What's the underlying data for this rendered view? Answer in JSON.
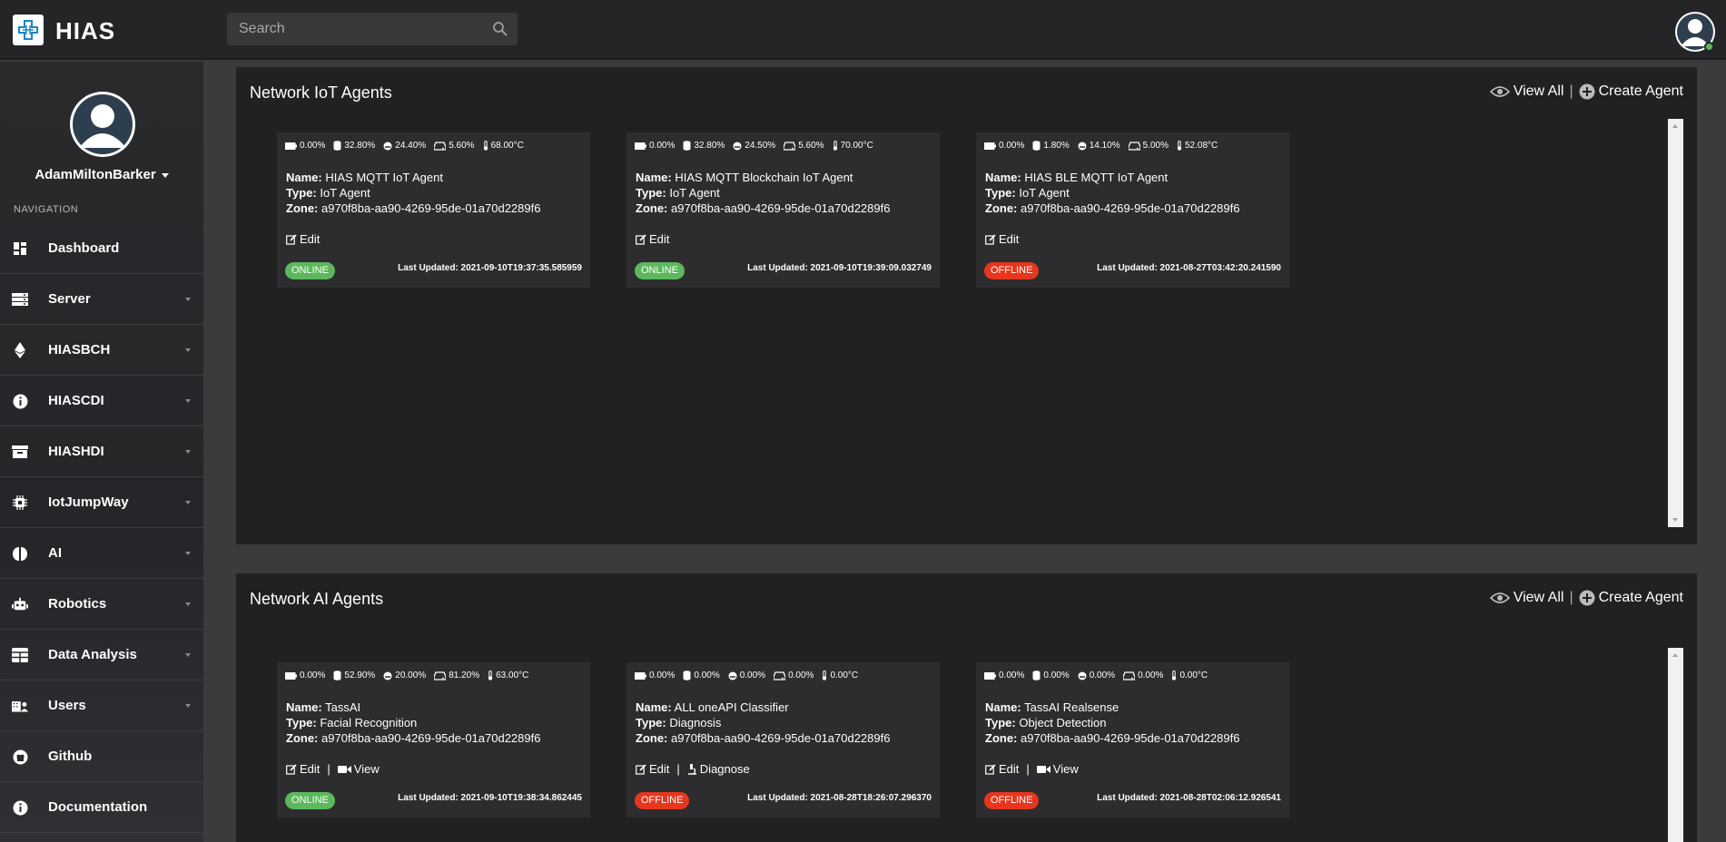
{
  "app": {
    "brand": "HIAS"
  },
  "search": {
    "placeholder": "Search"
  },
  "user": {
    "name": "AdamMiltonBarker"
  },
  "nav": {
    "section_label": "NAVIGATION",
    "items": [
      {
        "label": "Dashboard",
        "icon": "dashboard-icon",
        "has_caret": false
      },
      {
        "label": "Server",
        "icon": "server-icon",
        "has_caret": true
      },
      {
        "label": "HIASBCH",
        "icon": "ethereum-icon",
        "has_caret": true
      },
      {
        "label": "HIASCDI",
        "icon": "info-icon",
        "has_caret": true
      },
      {
        "label": "HIASHDI",
        "icon": "archive-icon",
        "has_caret": true
      },
      {
        "label": "IotJumpWay",
        "icon": "chip-icon",
        "has_caret": true
      },
      {
        "label": "AI",
        "icon": "brain-icon",
        "has_caret": true
      },
      {
        "label": "Robotics",
        "icon": "robot-icon",
        "has_caret": true
      },
      {
        "label": "Data Analysis",
        "icon": "table-icon",
        "has_caret": true
      },
      {
        "label": "Users",
        "icon": "users-icon",
        "has_caret": true
      },
      {
        "label": "Github",
        "icon": "github-icon",
        "has_caret": false
      },
      {
        "label": "Documentation",
        "icon": "info-icon",
        "has_caret": false
      }
    ]
  },
  "panels": {
    "iot": {
      "title": "Network IoT Agents",
      "view_all": "View All",
      "separator": "|",
      "create": "Create Agent",
      "agents": [
        {
          "battery": "0.00%",
          "cpu": "32.80%",
          "memory": "24.40%",
          "hdd": "5.60%",
          "temp": "68.00°C",
          "name_label": "Name:",
          "name": "HIAS MQTT IoT Agent",
          "type_label": "Type:",
          "type": "IoT Agent",
          "zone_label": "Zone:",
          "zone": "a970f8ba-aa90-4269-95de-01a70d2289f6",
          "edit": "Edit",
          "status": "ONLINE",
          "updated": "Last Updated: 2021-09-10T19:37:35.585959"
        },
        {
          "battery": "0.00%",
          "cpu": "32.80%",
          "memory": "24.50%",
          "hdd": "5.60%",
          "temp": "70.00°C",
          "name_label": "Name:",
          "name": "HIAS MQTT Blockchain IoT Agent",
          "type_label": "Type:",
          "type": "IoT Agent",
          "zone_label": "Zone:",
          "zone": "a970f8ba-aa90-4269-95de-01a70d2289f6",
          "edit": "Edit",
          "status": "ONLINE",
          "updated": "Last Updated: 2021-09-10T19:39:09.032749"
        },
        {
          "battery": "0.00%",
          "cpu": "1.80%",
          "memory": "14.10%",
          "hdd": "5.00%",
          "temp": "52.08°C",
          "name_label": "Name:",
          "name": "HIAS BLE MQTT IoT Agent",
          "type_label": "Type:",
          "type": "IoT Agent",
          "zone_label": "Zone:",
          "zone": "a970f8ba-aa90-4269-95de-01a70d2289f6",
          "edit": "Edit",
          "status": "OFFLINE",
          "updated": "Last Updated: 2021-08-27T03:42:20.241590"
        }
      ]
    },
    "ai": {
      "title": "Network AI Agents",
      "view_all": "View All",
      "separator": "|",
      "create": "Create Agent",
      "agents": [
        {
          "battery": "0.00%",
          "cpu": "52.90%",
          "memory": "20.00%",
          "hdd": "81.20%",
          "temp": "63.00°C",
          "name_label": "Name:",
          "name": "TassAI",
          "type_label": "Type:",
          "type": "Facial Recognition",
          "zone_label": "Zone:",
          "zone": "a970f8ba-aa90-4269-95de-01a70d2289f6",
          "edit": "Edit",
          "pipe": "|",
          "action": "View",
          "status": "ONLINE",
          "updated": "Last Updated: 2021-09-10T19:38:34.862445"
        },
        {
          "battery": "0.00%",
          "cpu": "0.00%",
          "memory": "0.00%",
          "hdd": "0.00%",
          "temp": "0.00°C",
          "name_label": "Name:",
          "name": "ALL oneAPI Classifier",
          "type_label": "Type:",
          "type": "Diagnosis",
          "zone_label": "Zone:",
          "zone": "a970f8ba-aa90-4269-95de-01a70d2289f6",
          "edit": "Edit",
          "pipe": "|",
          "action": "Diagnose",
          "status": "OFFLINE",
          "updated": "Last Updated: 2021-08-28T18:26:07.296370"
        },
        {
          "battery": "0.00%",
          "cpu": "0.00%",
          "memory": "0.00%",
          "hdd": "0.00%",
          "temp": "0.00°C",
          "name_label": "Name:",
          "name": "TassAI Realsense",
          "type_label": "Type:",
          "type": "Object Detection",
          "zone_label": "Zone:",
          "zone": "a970f8ba-aa90-4269-95de-01a70d2289f6",
          "edit": "Edit",
          "pipe": "|",
          "action": "View",
          "status": "OFFLINE",
          "updated": "Last Updated: 2021-08-28T02:06:12.926541"
        }
      ]
    }
  },
  "colors": {
    "online": "#5cb85c",
    "offline": "#e7361e",
    "panel_bg": "#212121",
    "card_bg": "#2d2d2f",
    "sidebar_bg": "#2a2a2d"
  }
}
